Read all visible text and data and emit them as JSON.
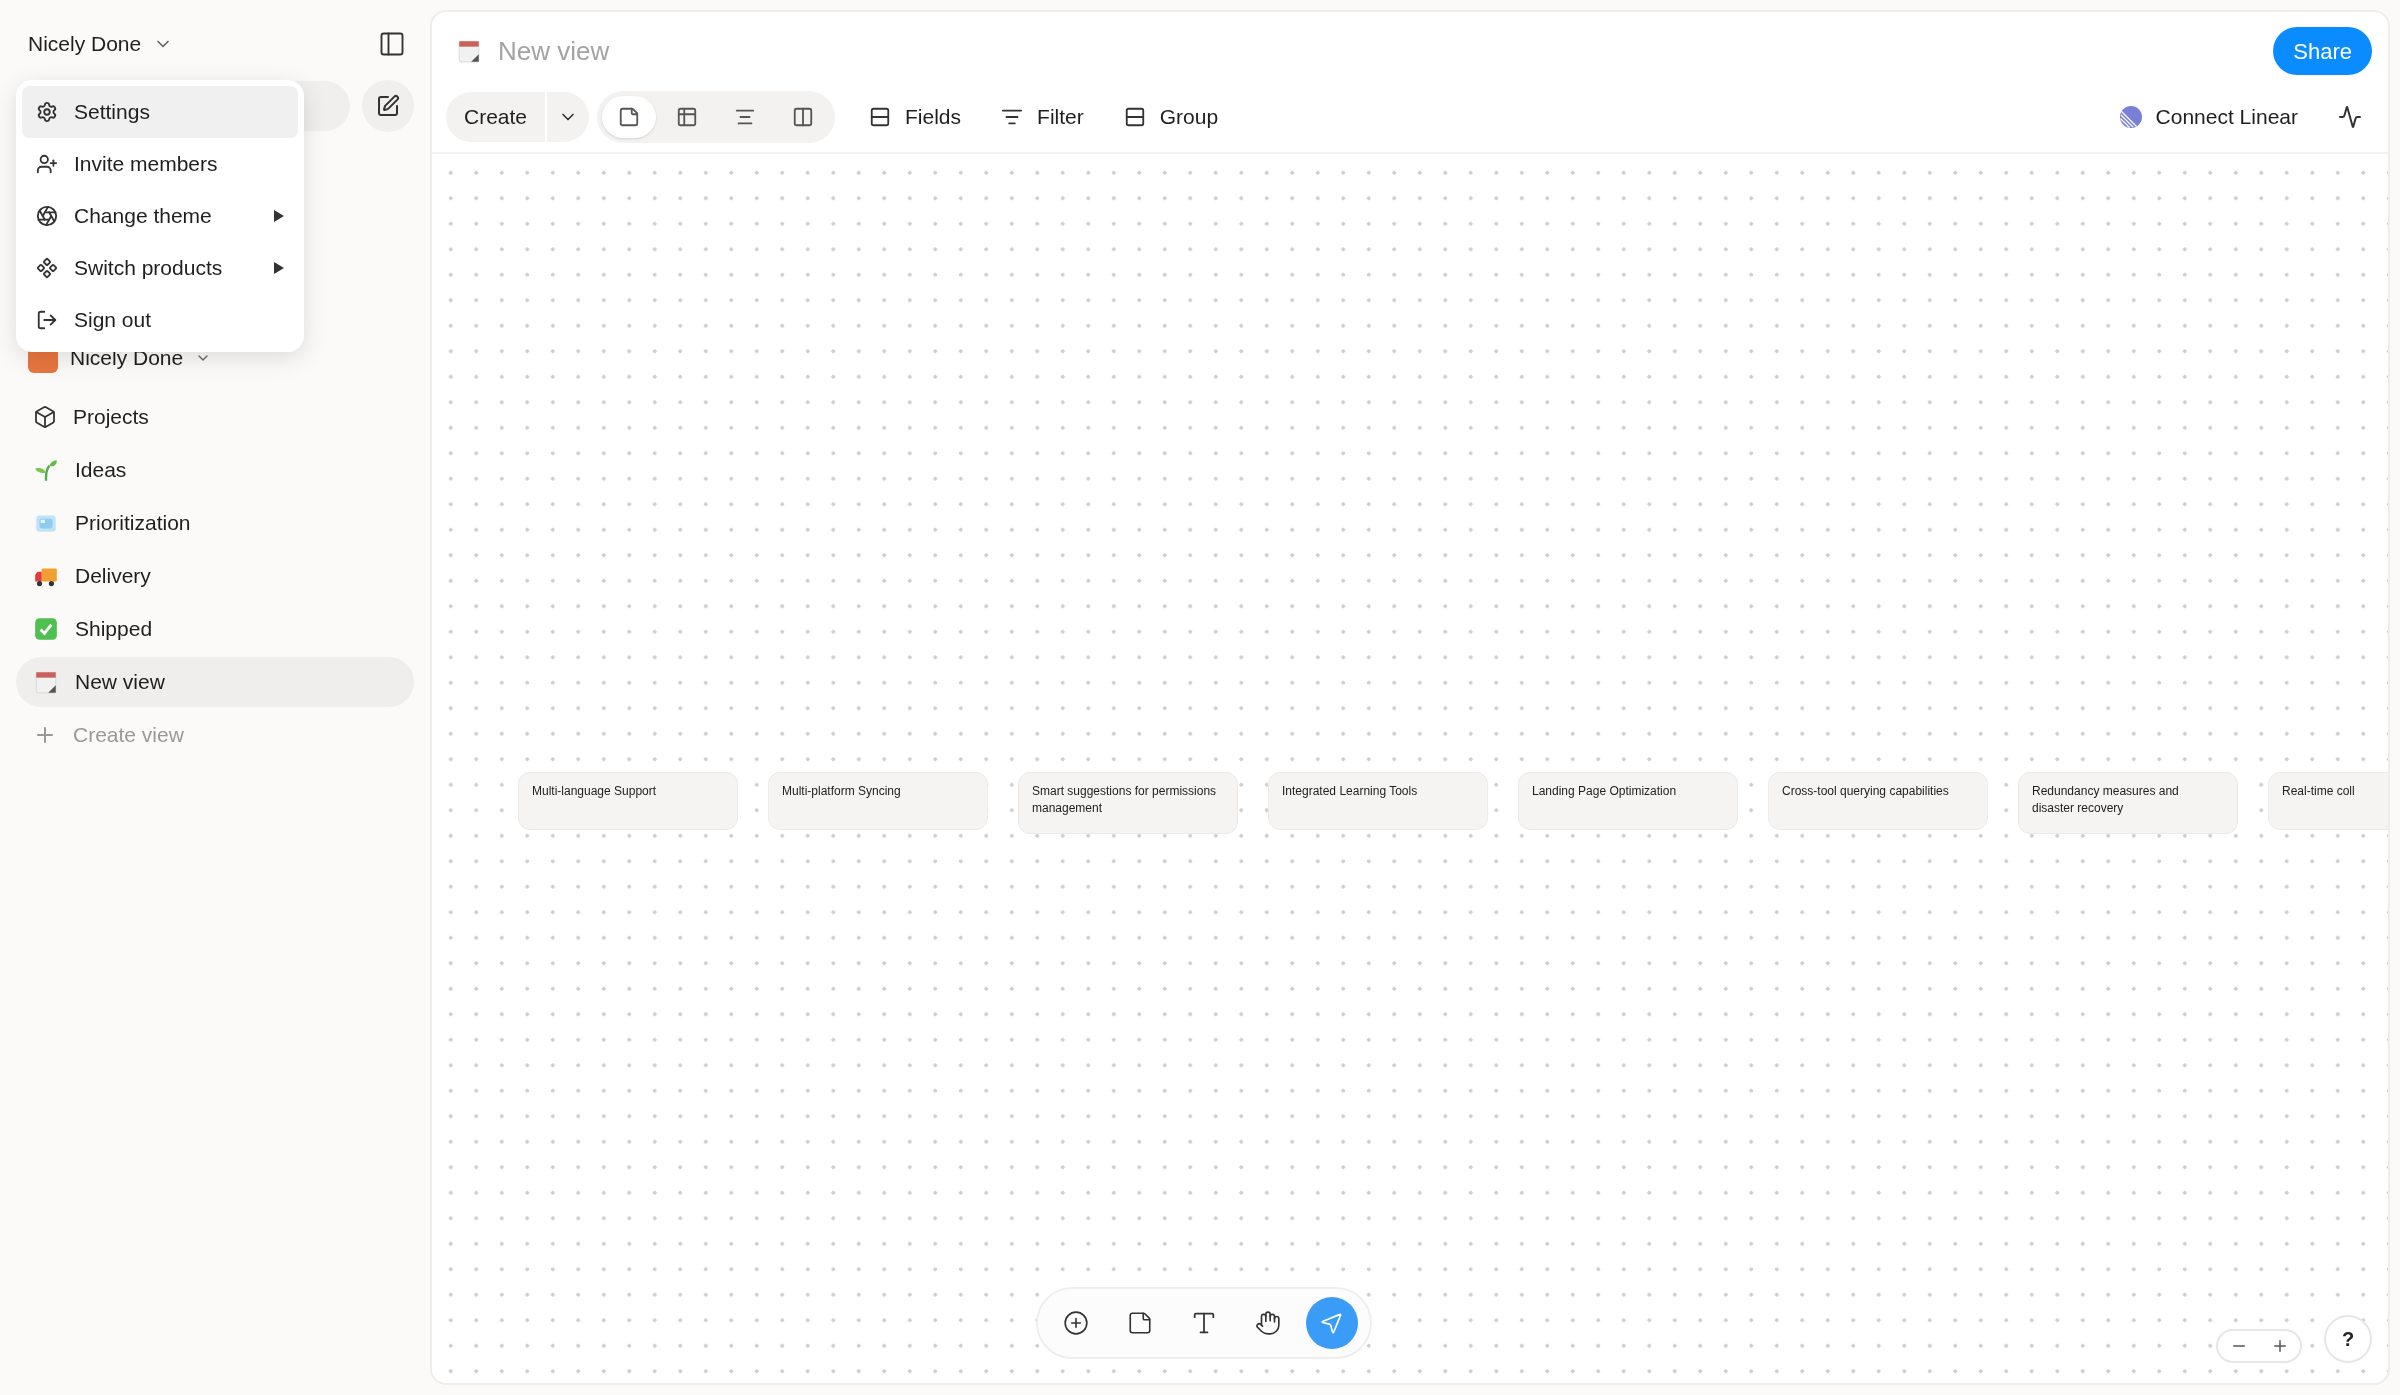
{
  "workspace_switcher": {
    "name": "Nicely Done"
  },
  "menu": {
    "items": [
      {
        "label": "Settings",
        "kind": "settings",
        "selected": true,
        "has_submenu": false
      },
      {
        "label": "Invite members",
        "kind": "invite",
        "selected": false,
        "has_submenu": false
      },
      {
        "label": "Change theme",
        "kind": "theme",
        "selected": false,
        "has_submenu": true
      },
      {
        "label": "Switch products",
        "kind": "products",
        "selected": false,
        "has_submenu": true
      },
      {
        "label": "Sign out",
        "kind": "signout",
        "selected": false,
        "has_submenu": false
      }
    ]
  },
  "workspace": {
    "name": "Nicely Done"
  },
  "nav": [
    {
      "label": "Projects",
      "kind": "cube",
      "selected": false
    },
    {
      "label": "Ideas",
      "kind": "sprout",
      "selected": false
    },
    {
      "label": "Prioritization",
      "kind": "ice",
      "selected": false
    },
    {
      "label": "Delivery",
      "kind": "truck",
      "selected": false
    },
    {
      "label": "Shipped",
      "kind": "check",
      "selected": false
    },
    {
      "label": "New view",
      "kind": "calendar",
      "selected": true
    }
  ],
  "create_view": "Create view",
  "view": {
    "title": "New view"
  },
  "share_button": "Share",
  "toolbar": {
    "create": "Create",
    "layouts": [
      {
        "kind": "sticky",
        "selected": true
      },
      {
        "kind": "table",
        "selected": false
      },
      {
        "kind": "timeline",
        "selected": false
      },
      {
        "kind": "board",
        "selected": false
      }
    ],
    "actions": [
      {
        "label": "Fields",
        "kind": "fields"
      },
      {
        "label": "Filter",
        "kind": "filter"
      },
      {
        "label": "Group",
        "kind": "group"
      }
    ],
    "integration": "Connect Linear"
  },
  "cards": [
    {
      "text": "Multi-language Support"
    },
    {
      "text": "Multi-platform Syncing"
    },
    {
      "text": "Smart suggestions for permissions management"
    },
    {
      "text": "Integrated Learning Tools"
    },
    {
      "text": "Landing Page Optimization"
    },
    {
      "text": "Cross-tool querying capabilities"
    },
    {
      "text": "Redundancy measures and disaster recovery"
    },
    {
      "text": "Real-time coll"
    }
  ],
  "tools": [
    {
      "kind": "add",
      "selected": false
    },
    {
      "kind": "sticky",
      "selected": false
    },
    {
      "kind": "text",
      "selected": false
    },
    {
      "kind": "hand",
      "selected": false
    },
    {
      "kind": "select",
      "selected": true
    }
  ],
  "help": "?"
}
